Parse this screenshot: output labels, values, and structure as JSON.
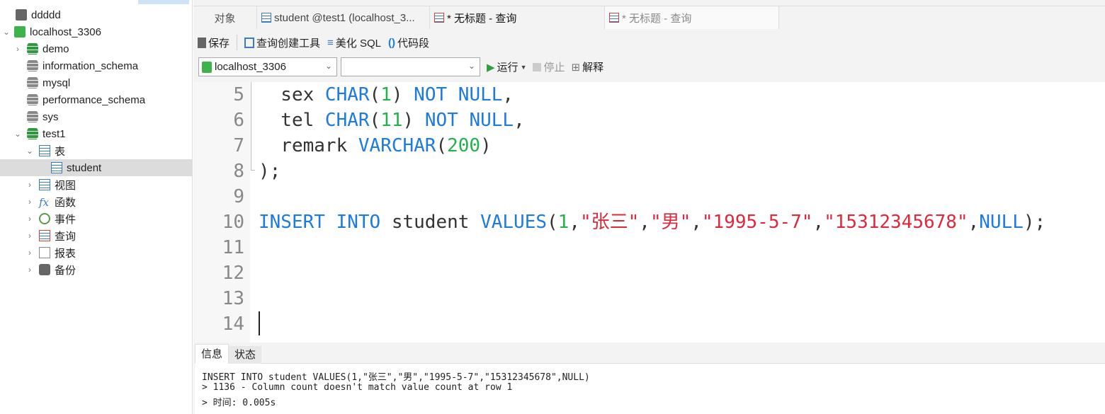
{
  "sidebar": {
    "items": [
      {
        "label": "ddddd"
      },
      {
        "label": "localhost_3306"
      },
      {
        "label": "demo"
      },
      {
        "label": "information_schema"
      },
      {
        "label": "mysql"
      },
      {
        "label": "performance_schema"
      },
      {
        "label": "sys"
      },
      {
        "label": "test1"
      },
      {
        "label": "表"
      },
      {
        "label": "student"
      },
      {
        "label": "视图"
      },
      {
        "label": "函数"
      },
      {
        "label": "事件"
      },
      {
        "label": "查询"
      },
      {
        "label": "报表"
      },
      {
        "label": "备份"
      }
    ]
  },
  "tabs": [
    {
      "label": "对象"
    },
    {
      "label": "student @test1 (localhost_3..."
    },
    {
      "label": "* 无标题 - 查询"
    },
    {
      "label": "* 无标题 - 查询"
    }
  ],
  "toolbar": {
    "save": "保存",
    "query_builder": "查询创建工具",
    "beautify": "美化 SQL",
    "snippet": "代码段",
    "run": "运行",
    "stop": "停止",
    "explain": "解释"
  },
  "connection_select": {
    "value": "localhost_3306"
  },
  "database_select": {
    "value": ""
  },
  "editor": {
    "lines": [
      {
        "n": "5",
        "tokens": [
          [
            "  sex ",
            "pl"
          ],
          [
            "CHAR",
            "kw"
          ],
          [
            "(",
            "pl"
          ],
          [
            "1",
            "num"
          ],
          [
            ") ",
            "pl"
          ],
          [
            "NOT NULL",
            "kw"
          ],
          [
            ",",
            "pl"
          ]
        ]
      },
      {
        "n": "6",
        "tokens": [
          [
            "  tel ",
            "pl"
          ],
          [
            "CHAR",
            "kw"
          ],
          [
            "(",
            "pl"
          ],
          [
            "11",
            "num"
          ],
          [
            ") ",
            "pl"
          ],
          [
            "NOT NULL",
            "kw"
          ],
          [
            ",",
            "pl"
          ]
        ]
      },
      {
        "n": "7",
        "tokens": [
          [
            "  remark ",
            "pl"
          ],
          [
            "VARCHAR",
            "kw"
          ],
          [
            "(",
            "pl"
          ],
          [
            "200",
            "num"
          ],
          [
            ")",
            "pl"
          ]
        ]
      },
      {
        "n": "8",
        "tokens": [
          [
            ");",
            "pl"
          ]
        ]
      },
      {
        "n": "9",
        "tokens": []
      },
      {
        "n": "10",
        "tokens": [
          [
            "INSERT INTO",
            "kw"
          ],
          [
            " student ",
            "pl"
          ],
          [
            "VALUES",
            "kw"
          ],
          [
            "(",
            "pl"
          ],
          [
            "1",
            "num"
          ],
          [
            ",",
            "pl"
          ],
          [
            "\"张三\"",
            "str"
          ],
          [
            ",",
            "pl"
          ],
          [
            "\"男\"",
            "str"
          ],
          [
            ",",
            "pl"
          ],
          [
            "\"1995-5-7\"",
            "str"
          ],
          [
            ",",
            "pl"
          ],
          [
            "\"15312345678\"",
            "str"
          ],
          [
            ",",
            "pl"
          ],
          [
            "NULL",
            "kw"
          ],
          [
            ");",
            "pl"
          ]
        ]
      },
      {
        "n": "11",
        "tokens": []
      },
      {
        "n": "12",
        "tokens": []
      },
      {
        "n": "13",
        "tokens": []
      },
      {
        "n": "14",
        "tokens": []
      }
    ]
  },
  "bottom": {
    "tabs": [
      {
        "label": "信息"
      },
      {
        "label": "状态"
      }
    ],
    "messages": [
      "INSERT INTO student VALUES(1,\"张三\",\"男\",\"1995-5-7\",\"15312345678\",NULL)",
      "> 1136 - Column count doesn't match value count at row 1",
      "> 时间: 0.005s"
    ]
  },
  "colors": {
    "keyword": "#1c7ae0",
    "number": "#23b14d",
    "string": "#e0273c"
  }
}
